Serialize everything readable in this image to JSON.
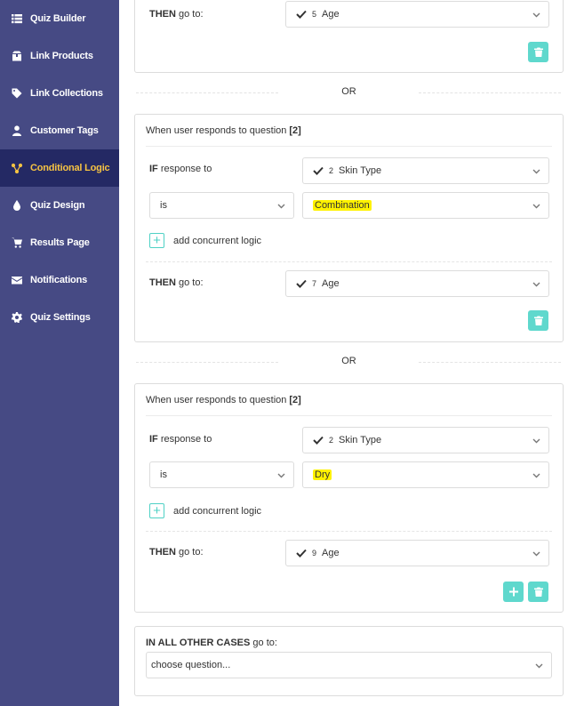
{
  "sidebar": {
    "items": [
      {
        "label": "Quiz Builder",
        "icon": "list-icon"
      },
      {
        "label": "Link Products",
        "icon": "box-icon"
      },
      {
        "label": "Link Collections",
        "icon": "tag-icon"
      },
      {
        "label": "Customer Tags",
        "icon": "user-icon"
      },
      {
        "label": "Conditional Logic",
        "icon": "branch-icon",
        "active": true
      },
      {
        "label": "Quiz Design",
        "icon": "droplet-icon"
      },
      {
        "label": "Results Page",
        "icon": "cart-icon"
      },
      {
        "label": "Notifications",
        "icon": "envelope-icon"
      },
      {
        "label": "Quiz Settings",
        "icon": "gear-icon"
      }
    ],
    "colors": {
      "background": "#464a84",
      "active_background": "#242964",
      "active_text": "#f6c343"
    }
  },
  "rule0": {
    "then_label_bold": "THEN",
    "then_label_rest": " go to:",
    "then_num": "5",
    "then_value": "Age"
  },
  "or_text": "OR",
  "rule1": {
    "header_text": "When user responds to question",
    "header_q": "[2]",
    "if_label_bold": "IF",
    "if_label_rest": " response to",
    "question_num": "2",
    "question_value": "Skin Type",
    "operator": "is",
    "answer": "Combination",
    "add_logic": "add concurrent logic",
    "then_label_bold": "THEN",
    "then_label_rest": " go to:",
    "then_num": "7",
    "then_value": "Age"
  },
  "rule2": {
    "header_text": "When user responds to question",
    "header_q": "[2]",
    "if_label_bold": "IF",
    "if_label_rest": " response to",
    "question_num": "2",
    "question_value": "Skin Type",
    "operator": "is",
    "answer": "Dry",
    "add_logic": "add concurrent logic",
    "then_label_bold": "THEN",
    "then_label_rest": " go to:",
    "then_num": "9",
    "then_value": "Age"
  },
  "default_case": {
    "label_bold": "IN ALL OTHER CASES",
    "label_rest": " go to:",
    "placeholder": "choose question..."
  },
  "colors": {
    "accent": "#5fd8cd",
    "highlight": "#fff200"
  }
}
